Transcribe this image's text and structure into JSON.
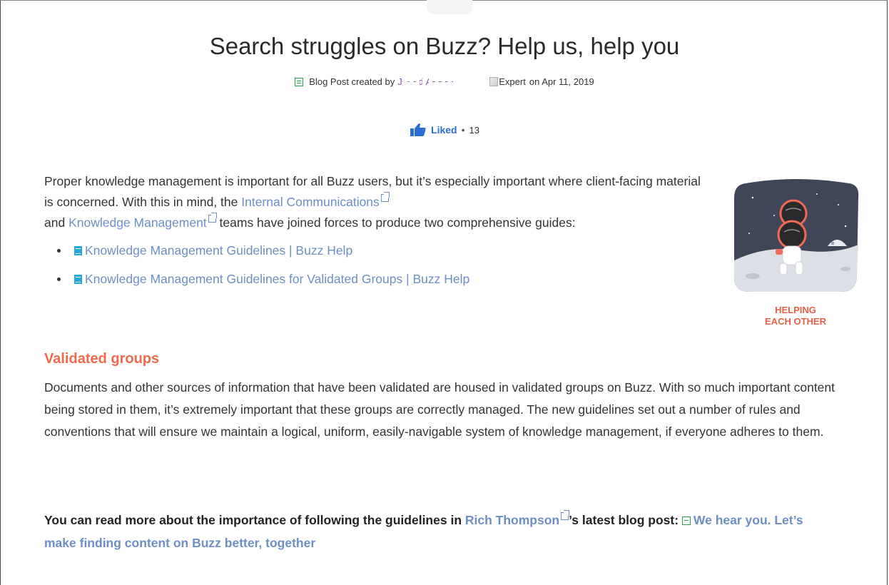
{
  "post": {
    "title": "Search struggles on Buzz? Help us, help you",
    "meta_prefix": "Blog Post created by",
    "author": "J−−−d A−−−−",
    "author_badge_alt": "Expert",
    "date": "on Apr 11, 2019",
    "liked_label": "Liked",
    "liked_separator": "•",
    "liked_count": "13"
  },
  "intro": {
    "text1": "Proper knowledge management is important for all Buzz users, but it’s especially important where client-facing material is concerned. With this in mind, the ",
    "link1": "Internal Communications",
    "text2": " and ",
    "link2": "Knowledge Management",
    "text3": " teams have joined forces to produce two comprehensive guides:"
  },
  "guides": [
    {
      "label": "Knowledge Management Guidelines | Buzz Help"
    },
    {
      "label": "Knowledge Management Guidelines for Validated Groups | Buzz Help"
    }
  ],
  "promo": {
    "caption_line1": "HELPING",
    "caption_line2": "EACH OTHER"
  },
  "section": {
    "heading": "Validated groups",
    "body": "Documents and other sources of information that have been validated are housed in validated groups on Buzz. With so much important content being stored in them, it’s extremely important that these groups are correctly managed. The new guidelines set out a number of rules and conventions that will ensure we maintain a logical, uniform, easily-navigable system of knowledge management, if everyone adheres to them."
  },
  "closing": {
    "text1": "You can read more about the importance of following the guidelines in ",
    "author_link": "Rich Thompson",
    "text2": "’s latest blog post: ",
    "post_link": "We hear you. Let’s make finding content on Buzz better, together"
  },
  "colors": {
    "accent_heading": "#ef6a4c",
    "link": "#6d8fc5",
    "liked": "#2b6fd1"
  }
}
